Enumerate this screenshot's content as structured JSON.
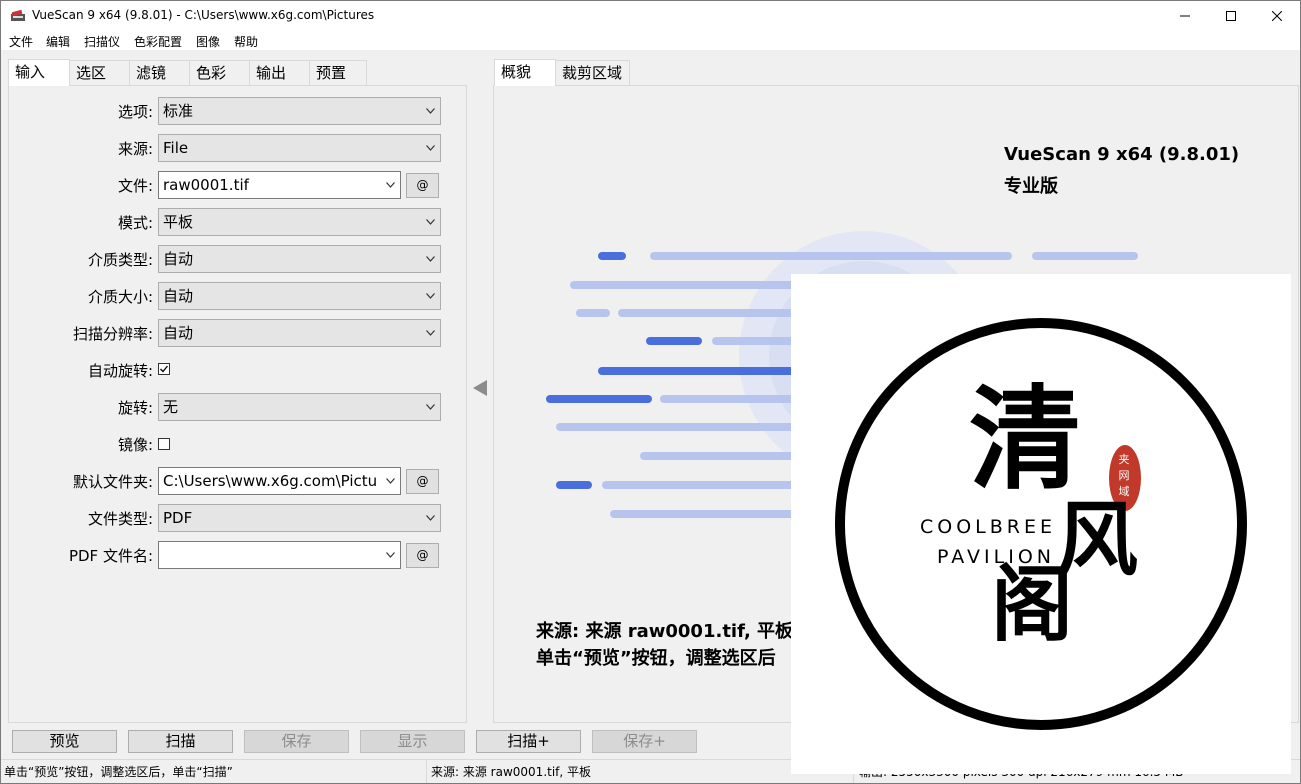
{
  "window": {
    "title": "VueScan 9 x64 (9.8.01) - C:\\Users\\www.x6g.com\\Pictures",
    "controls": [
      "minimize-icon",
      "maximize-icon",
      "close-icon"
    ]
  },
  "menu": [
    "文件",
    "编辑",
    "扫描仪",
    "色彩配置",
    "图像",
    "帮助"
  ],
  "left_tabs": [
    "输入",
    "选区",
    "滤镜",
    "色彩",
    "输出",
    "预置"
  ],
  "right_tabs": [
    "概貌",
    "裁剪区域"
  ],
  "form": {
    "options": {
      "label": "选项:",
      "value": "标准"
    },
    "source": {
      "label": "来源:",
      "value": "File"
    },
    "file": {
      "label": "文件:",
      "value": "raw0001.tif",
      "at": "@"
    },
    "mode": {
      "label": "模式:",
      "value": "平板"
    },
    "media_type": {
      "label": "介质类型:",
      "value": "自动"
    },
    "media_size": {
      "label": "介质大小:",
      "value": "自动"
    },
    "scan_resolution": {
      "label": "扫描分辨率:",
      "value": "自动"
    },
    "auto_rotate": {
      "label": "自动旋转:",
      "checked": true
    },
    "rotate": {
      "label": "旋转:",
      "value": "无"
    },
    "mirror": {
      "label": "镜像:",
      "checked": false
    },
    "default_folder": {
      "label": "默认文件夹:",
      "value": "C:\\Users\\www.x6g.com\\Pictu",
      "at": "@"
    },
    "file_type": {
      "label": "文件类型:",
      "value": "PDF"
    },
    "pdf_file_name": {
      "label": "PDF 文件名:",
      "value": "",
      "at": "@"
    }
  },
  "preview": {
    "product": "VueScan 9 x64 (9.8.01)",
    "edition": "专业版",
    "message_line1": "来源: 来源 raw0001.tif, 平板",
    "message_line2": "单击“预览”按钮，调整选区后",
    "collapse_icon": "triangle-left-icon",
    "colors": {
      "dark": "#4a6fdc",
      "light": "#b7c5ee"
    }
  },
  "watermark": {
    "char_main": "清",
    "char_wind": "风",
    "char_pavilion": "阁",
    "seal": "夹网域",
    "en_line1": "COOLBREE",
    "en_line2": "PAVILION"
  },
  "buttons": {
    "preview": "预览",
    "scan": "扫描",
    "save": "保存",
    "show": "显示",
    "scan_plus": "扫描+",
    "save_plus": "保存+"
  },
  "status": {
    "left": "单击“预览”按钮，调整选区后，单击“扫描”",
    "middle": "来源: 来源 raw0001.tif, 平板",
    "right": "输出: 2550x3300 pixels 300 dpi 216x279 mm 16.5 MB"
  }
}
